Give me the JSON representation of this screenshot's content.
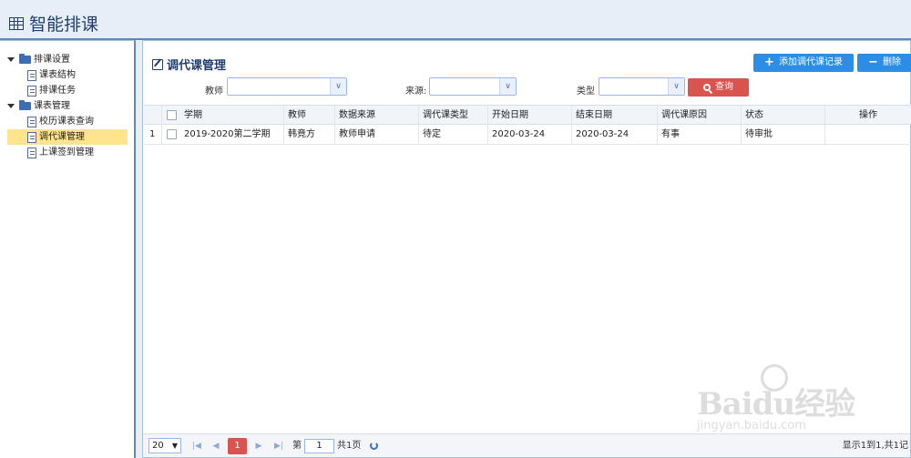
{
  "app": {
    "title": "智能排课"
  },
  "sidebar": {
    "groups": [
      {
        "label": "排课设置",
        "items": [
          "课表结构",
          "排课任务"
        ]
      },
      {
        "label": "课表管理",
        "items": [
          "校历课表查询",
          "调代课管理",
          "上课签到管理"
        ]
      }
    ],
    "selected": "调代课管理"
  },
  "main": {
    "title": "调代课管理",
    "buttons": {
      "add": "添加调代课记录",
      "delete": "删除",
      "query": "查询"
    },
    "filters": {
      "teacher_label": "教师",
      "source_label": "来源:",
      "type_label": "类型",
      "teacher_value": "",
      "source_value": "",
      "type_value": ""
    },
    "table": {
      "columns": [
        "学期",
        "教师",
        "数据来源",
        "调代课类型",
        "开始日期",
        "结束日期",
        "调代课原因",
        "状态",
        "操作"
      ],
      "rows": [
        {
          "index": "1",
          "cells": [
            "2019-2020第二学期",
            "韩竟方",
            "教师申请",
            "待定",
            "2020-03-24",
            "2020-03-24",
            "有事",
            "待审批",
            ""
          ]
        }
      ]
    },
    "pager": {
      "page_size": "20",
      "current_page": "1",
      "page_prefix": "第",
      "page_input": "1",
      "total_pages": "共1页",
      "summary": "显示1到1,共1记"
    }
  },
  "watermark": {
    "brand": "Baidu经验",
    "url": "jingyan.baidu.com"
  }
}
